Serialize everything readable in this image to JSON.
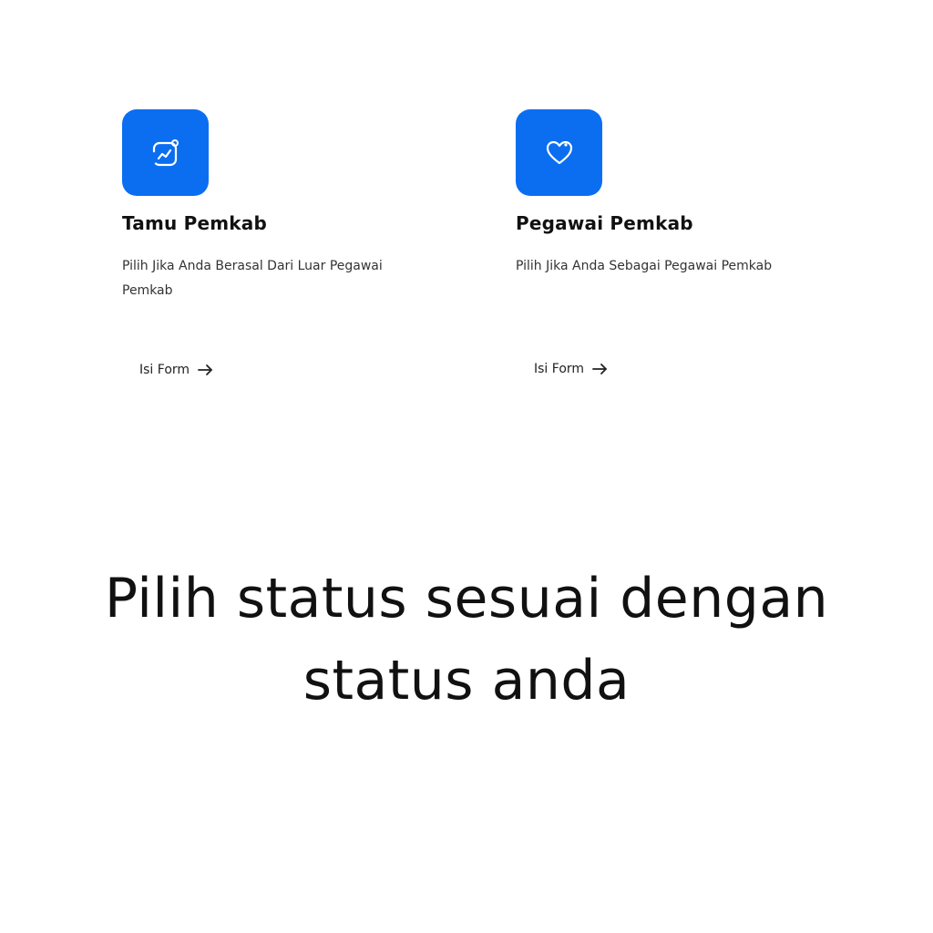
{
  "options": [
    {
      "title": "Tamu Pemkab",
      "description": "Pilih Jika Anda Berasal Dari Luar Pegawai Pemkab",
      "link_label": "Isi Form",
      "icon": "chart-trend-icon"
    },
    {
      "title": "Pegawai Pemkab",
      "description": "Pilih Jika Anda Sebagai Pegawai Pemkab",
      "link_label": "Isi Form",
      "icon": "heart-icon"
    }
  ],
  "caption": {
    "line1": "Pilih status sesuai dengan",
    "line2": "status anda"
  },
  "colors": {
    "accent": "#0b6ef0",
    "text": "#111111",
    "background": "#ffffff"
  }
}
